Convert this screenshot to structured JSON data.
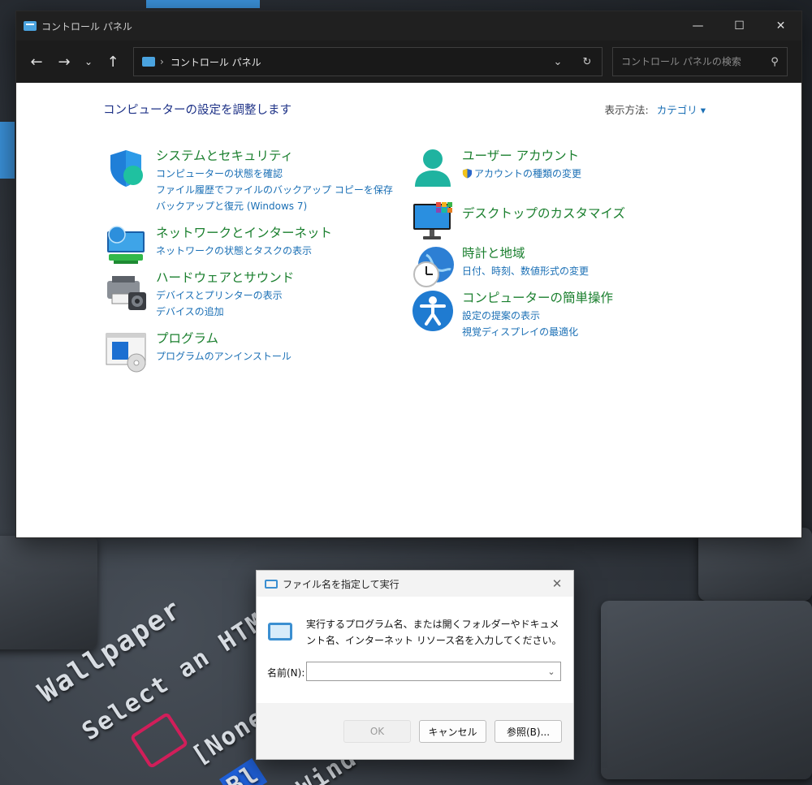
{
  "window": {
    "title": "コントロール パネル",
    "minimize": "—",
    "maximize": "☐",
    "close": "✕"
  },
  "nav": {
    "back": "←",
    "forward": "→",
    "recent": "⌄",
    "up": "↑",
    "breadcrumb_sep": "›",
    "breadcrumb": "コントロール パネル",
    "address_dropdown": "⌄",
    "refresh": "↻",
    "search_placeholder": "コントロール パネルの検索",
    "search_icon": "⚲"
  },
  "main": {
    "title": "コンピューターの設定を調整します",
    "view_label": "表示方法:",
    "view_value": "カテゴリ ▾"
  },
  "categories_left": [
    {
      "title": "システムとセキュリティ",
      "icon": "shield-icon",
      "links": [
        "コンピューターの状態を確認",
        "ファイル履歴でファイルのバックアップ コピーを保存",
        "バックアップと復元 (Windows 7)"
      ]
    },
    {
      "title": "ネットワークとインターネット",
      "icon": "network-globe-icon",
      "links": [
        "ネットワークの状態とタスクの表示"
      ]
    },
    {
      "title": "ハードウェアとサウンド",
      "icon": "printer-speaker-icon",
      "links": [
        "デバイスとプリンターの表示",
        "デバイスの追加"
      ]
    },
    {
      "title": "プログラム",
      "icon": "programs-disc-icon",
      "links": [
        "プログラムのアンインストール"
      ]
    }
  ],
  "categories_right": [
    {
      "title": "ユーザー アカウント",
      "icon": "user-account-icon",
      "links": [
        "アカウントの種類の変更"
      ]
    },
    {
      "title": "デスクトップのカスタマイズ",
      "icon": "monitor-icon",
      "links": []
    },
    {
      "title": "時計と地域",
      "icon": "clock-globe-icon",
      "links": [
        "日付、時刻、数値形式の変更"
      ]
    },
    {
      "title": "コンピューターの簡単操作",
      "icon": "accessibility-icon",
      "links": [
        "設定の提案の表示",
        "視覚ディスプレイの最適化"
      ]
    }
  ],
  "run_dialog": {
    "title": "ファイル名を指定して実行",
    "close": "✕",
    "description": "実行するプログラム名、または開くフォルダーやドキュメント名、インターネット リソース名を入力してください。",
    "name_label": "名前(N):",
    "name_value": "",
    "dropdown": "⌄",
    "ok": "OK",
    "cancel": "キャンセル",
    "browse": "参照(B)..."
  },
  "wallpaper": {
    "line1": "Wallpaper",
    "line2": "Select an HTML",
    "line3": "[None",
    "line4": "Bl",
    "line5": "Wind"
  },
  "colors": {
    "category_title": "#1a7f2e",
    "link": "#1a6fb5",
    "page_title": "#1e3287",
    "titlebar": "#202020"
  }
}
